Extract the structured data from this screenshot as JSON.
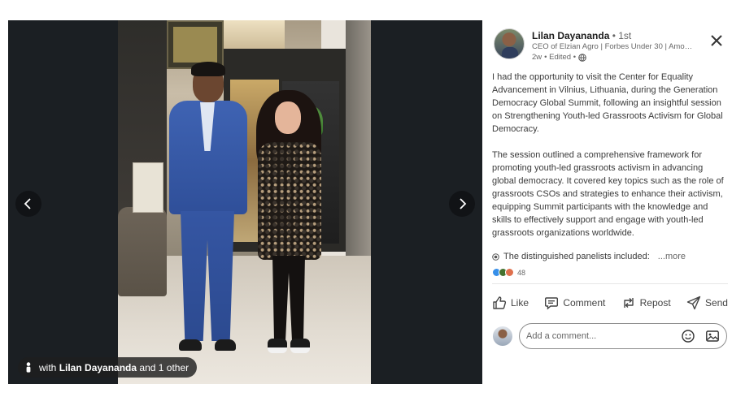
{
  "viewer": {
    "tag_prefix": "with",
    "tag_name": "Lilan Dayananda",
    "tag_suffix": "and 1 other",
    "prev_label": "‹",
    "next_label": "›"
  },
  "author": {
    "name": "Lilan Dayananda",
    "degree": "• 1st",
    "headline": "CEO of Elzian Agro | Forbes Under 30 | Amon...",
    "time": "2w",
    "edited": "• Edited •"
  },
  "post": {
    "paragraph1": "I had the opportunity to visit the Center for Equality Advancement in Vilnius, Lithuania, during the Generation Democracy Global Summit, following an insightful session on Strengthening Youth-led Grassroots Activism for Global Democracy.",
    "paragraph2": "The session outlined a comprehensive framework for promoting youth-led grassroots activism in advancing global democracy. It covered key topics such as the role of grassroots CSOs and strategies to enhance their activism, equipping Summit participants with the knowledge and skills to effectively support and engage with youth-led grassroots organizations worldwide.",
    "panelists_text": "The distinguished panelists included:",
    "more_label": "...more"
  },
  "reactions": {
    "count": "48",
    "types": [
      "like",
      "celebrate",
      "love"
    ]
  },
  "actions": {
    "like": "Like",
    "comment": "Comment",
    "repost": "Repost",
    "send": "Send"
  },
  "comment": {
    "placeholder": "Add a comment..."
  },
  "icons": {
    "close": "close-icon",
    "globe": "globe-icon",
    "person": "person-tag-icon",
    "bullet": "bullet-icon",
    "emoji": "emoji-icon",
    "image": "image-icon"
  },
  "colors": {
    "viewer_bg": "#1b1f23",
    "link_blue": "#0a66c2",
    "like_blue": "#378fe9",
    "celebrate_green": "#44712e",
    "love_red": "#df704d"
  }
}
